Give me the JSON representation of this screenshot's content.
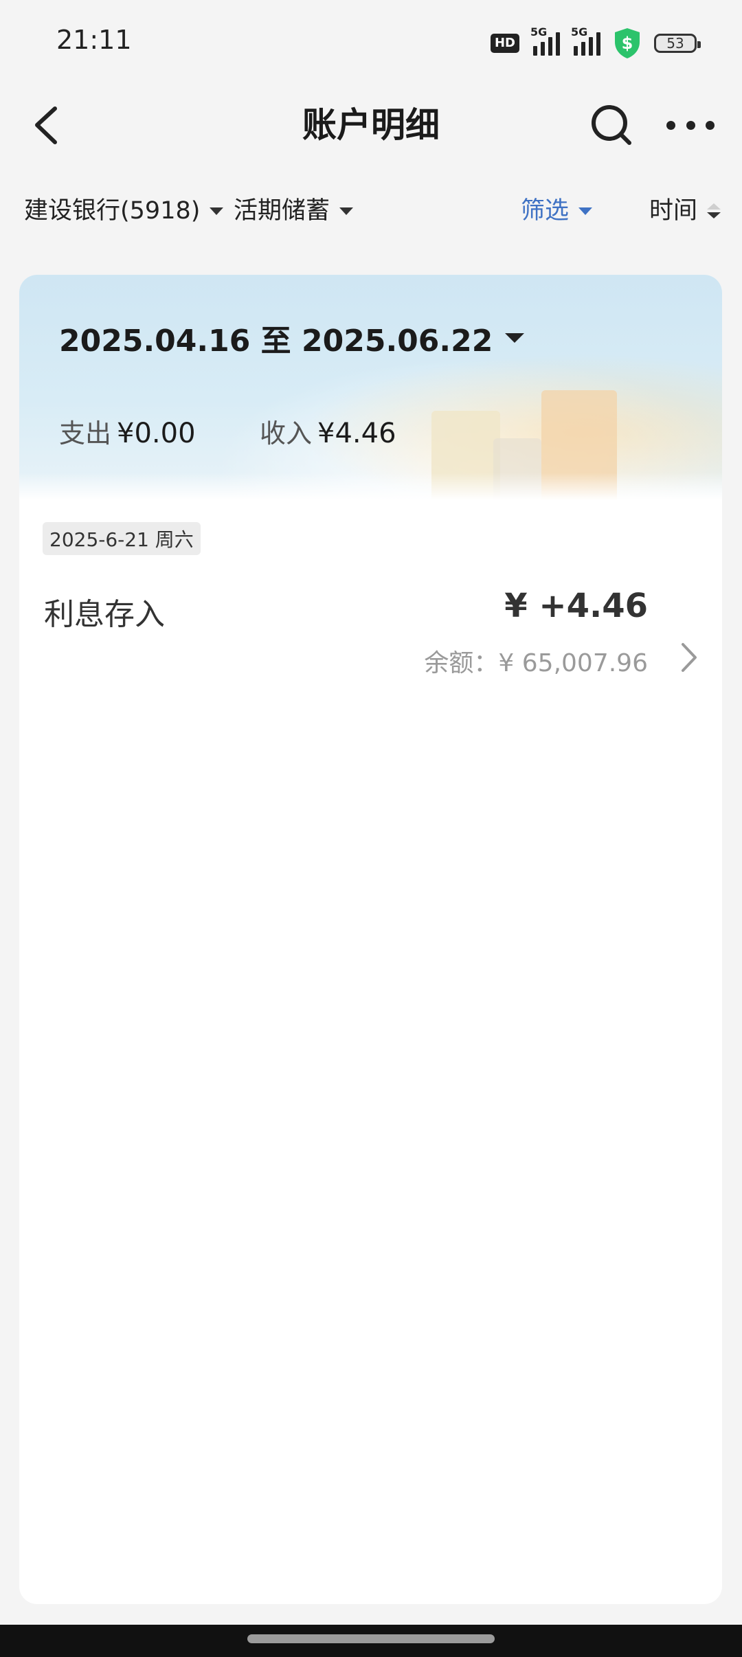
{
  "status_bar": {
    "time": "21:11",
    "hd_label": "HD",
    "signal1_label": "5G",
    "signal2_label": "5G",
    "battery_level": "53",
    "icons": [
      "hd-icon",
      "signal-5g-icon",
      "signal-5g-icon",
      "shield-dollar-icon",
      "battery-icon"
    ],
    "shield_color": "#2cc36b"
  },
  "nav": {
    "title": "账户明细",
    "icons": [
      "back-arrow-icon",
      "search-icon",
      "more-icon"
    ]
  },
  "filters": {
    "bank": "建设银行(5918)",
    "account_type": "活期储蓄",
    "filter": "筛选",
    "sort": "时间",
    "accent_color": "#3f72c4"
  },
  "summary": {
    "date_range": "2025.04.16 至 2025.06.22",
    "expense_label": "支出",
    "expense_value": "¥0.00",
    "income_label": "收入",
    "income_value": "¥4.46"
  },
  "transactions": [
    {
      "day": "2025-6-21 周六",
      "name": "利息存入",
      "amount": "¥ +4.46",
      "balance": "余额：¥ 65,007.96"
    }
  ]
}
